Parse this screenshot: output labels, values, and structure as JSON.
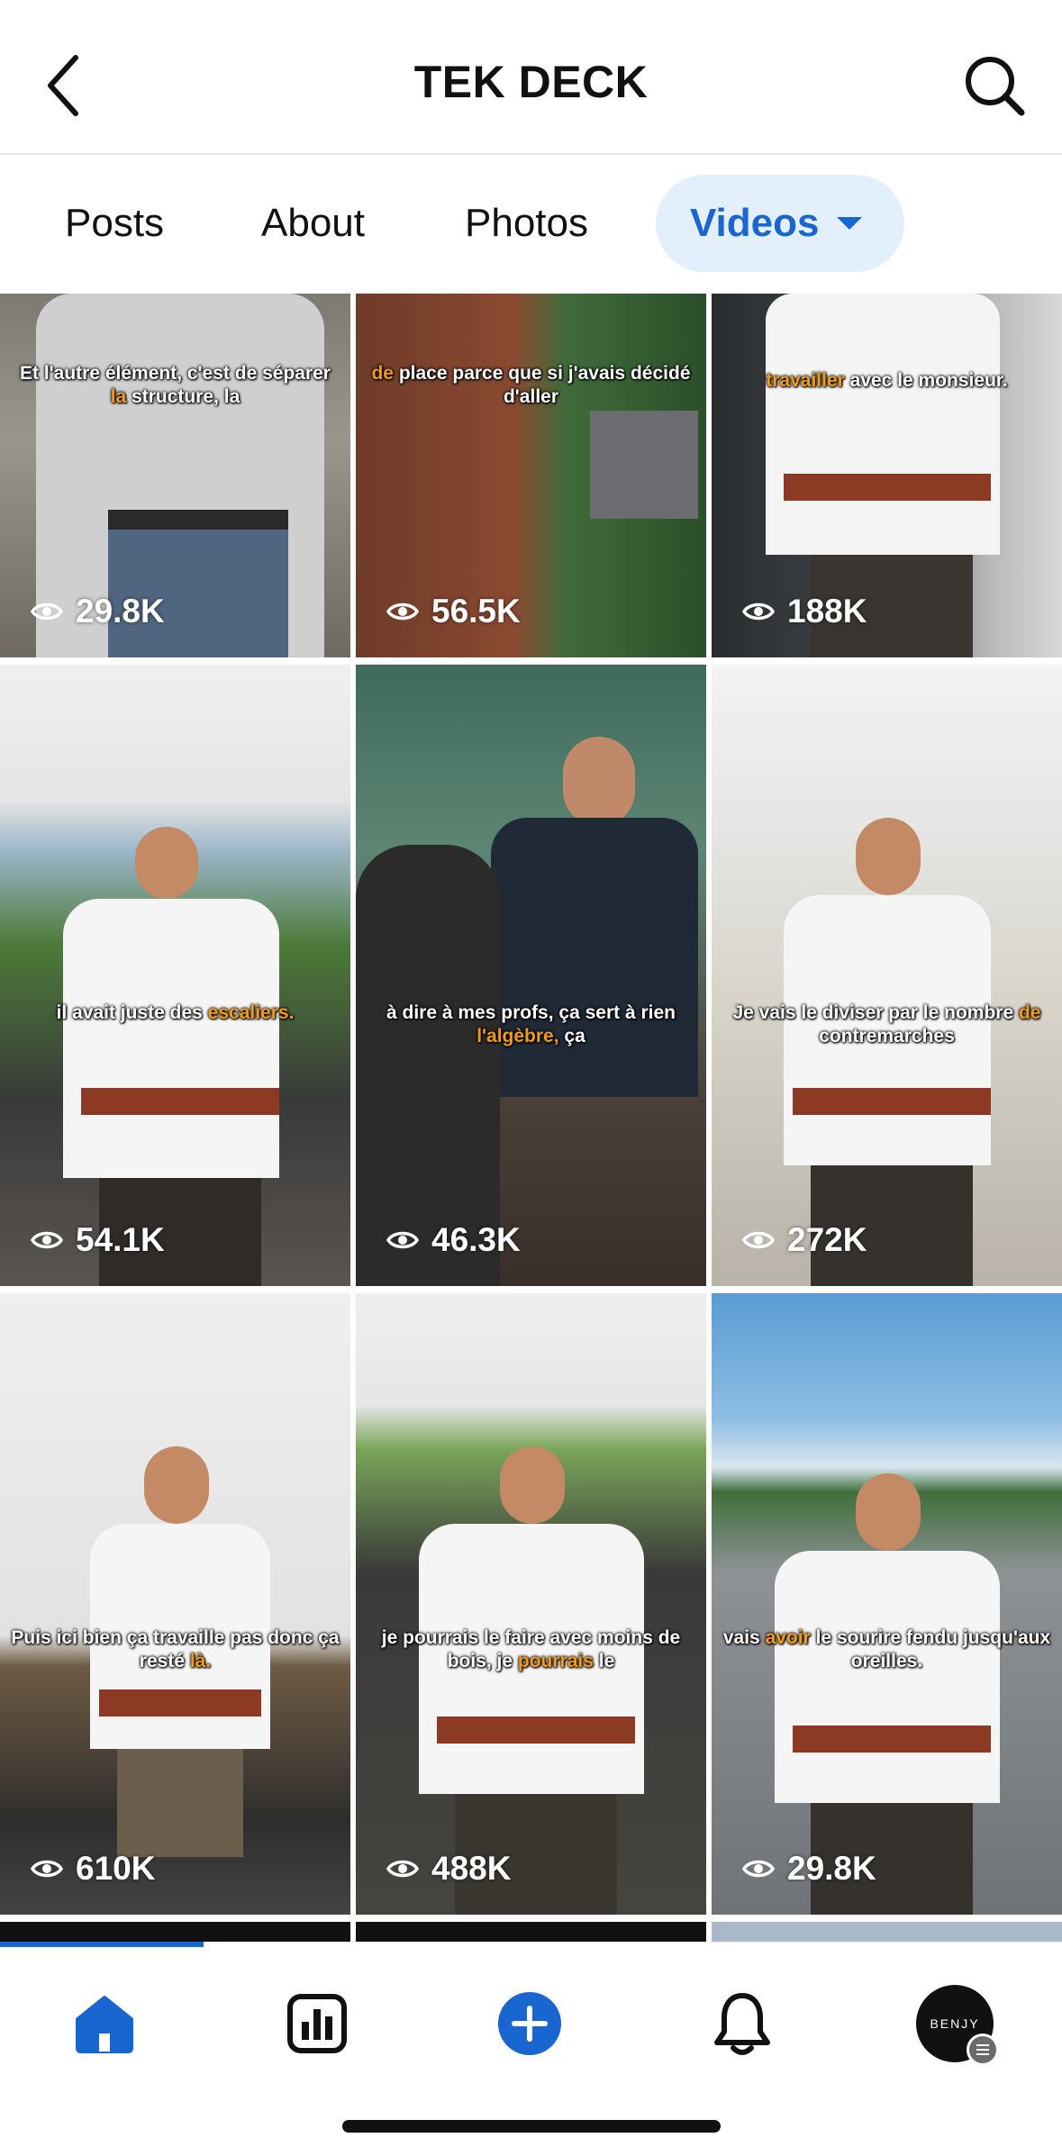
{
  "header": {
    "title": "TEK DECK"
  },
  "tabs": [
    {
      "label": "Posts",
      "active": false
    },
    {
      "label": "About",
      "active": false
    },
    {
      "label": "Photos",
      "active": false
    },
    {
      "label": "Videos",
      "active": true
    }
  ],
  "videos": [
    {
      "caption_before": "Et l'autre élément, c'est de séparer ",
      "caption_highlight": "la",
      "caption_after": " structure, la",
      "views": "29.8K"
    },
    {
      "caption_before": "",
      "caption_highlight": "de",
      "caption_after": " place parce que si j'avais décidé d'aller",
      "views": "56.5K"
    },
    {
      "caption_before": "",
      "caption_highlight": "travailler",
      "caption_after": " avec le monsieur.",
      "views": "188K"
    },
    {
      "caption_before": "il avait juste des ",
      "caption_highlight": "escaliers.",
      "caption_after": "",
      "views": "54.1K"
    },
    {
      "caption_before": "à dire à mes profs, ça sert à rien ",
      "caption_highlight": "l'algèbre,",
      "caption_after": " ça",
      "views": "46.3K"
    },
    {
      "caption_before": "Je vais le diviser par le nombre ",
      "caption_highlight": "de",
      "caption_after": " contremarches",
      "views": "272K"
    },
    {
      "caption_before": "Puis ici bien ça travaille pas donc ça resté ",
      "caption_highlight": "là.",
      "caption_after": "",
      "views": "610K"
    },
    {
      "caption_before": "je pourrais le faire avec moins de bois, je ",
      "caption_highlight": "pourrais",
      "caption_after": " le",
      "views": "488K"
    },
    {
      "caption_before": "vais ",
      "caption_highlight": "avoir",
      "caption_after": " le sourire fendu jusqu'aux oreilles.",
      "views": "29.8K"
    }
  ],
  "profile": {
    "avatar_text": "BENJY"
  },
  "colors": {
    "accent": "#1a66d1",
    "tab_active_bg": "#e3f0fb",
    "caption_highlight": "#f39a1a"
  },
  "icons": [
    "back-chevron-icon",
    "search-icon",
    "eye-icon",
    "home-icon",
    "dashboard-icon",
    "create-plus-icon",
    "bell-icon"
  ]
}
